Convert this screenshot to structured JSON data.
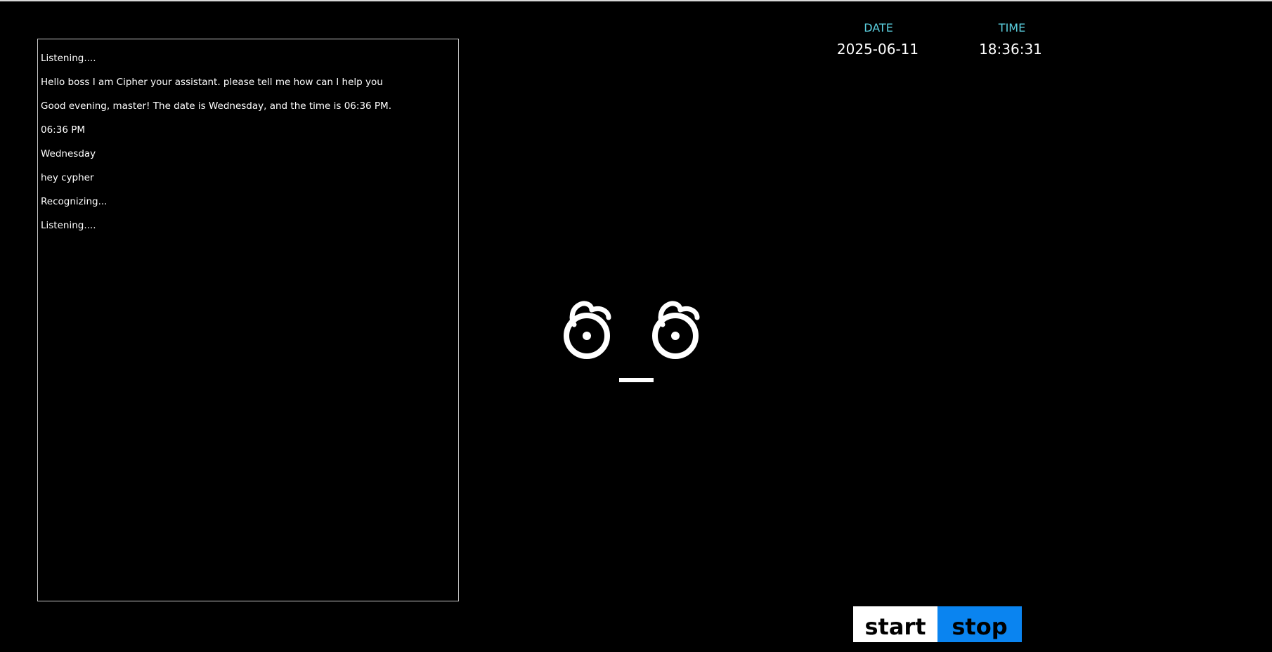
{
  "log": [
    "Listening....",
    "Hello boss I am Cipher your assistant. please tell me how can I help you",
    "Good evening, master! The date is Wednesday, and the time is 06:36 PM.",
    "06:36 PM",
    "Wednesday",
    "hey cypher",
    "Recognizing...",
    "Listening...."
  ],
  "datetime": {
    "date_label": "DATE",
    "time_label": "TIME",
    "date_value": "2025-06-11",
    "time_value": "18:36:31"
  },
  "controls": {
    "start_label": "start",
    "stop_label": "stop"
  },
  "colors": {
    "background": "#000000",
    "label_accent": "#5bd0e0",
    "stop_button": "#0a84f0",
    "start_button": "#ffffff"
  },
  "face": {
    "icon": "look-of-disapproval-face-icon"
  }
}
